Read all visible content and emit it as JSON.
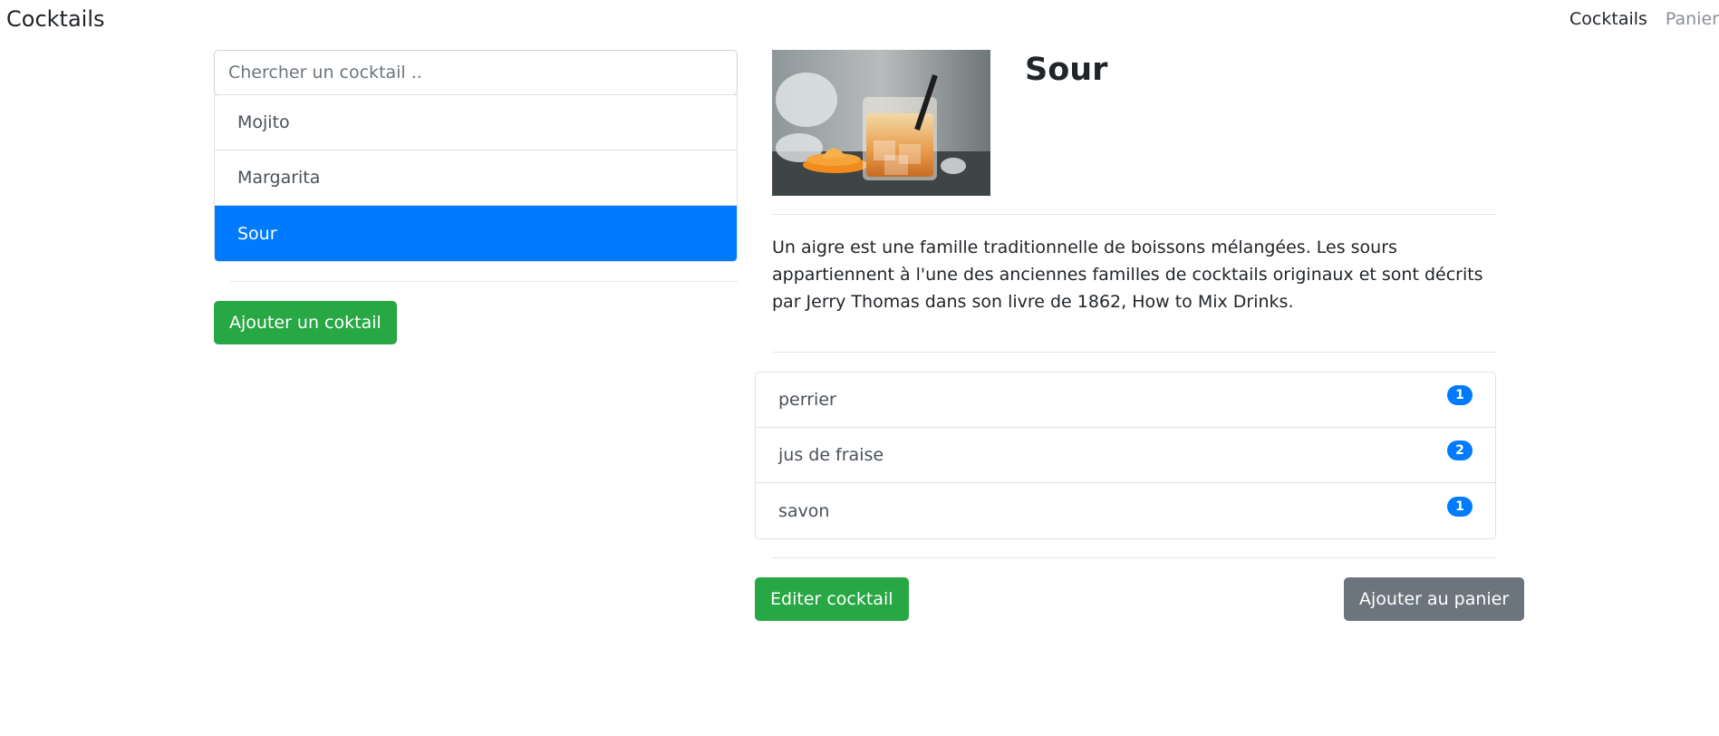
{
  "navbar": {
    "brand": "Cocktails",
    "links": [
      {
        "label": "Cocktails",
        "active": true
      },
      {
        "label": "Panier",
        "active": false
      }
    ]
  },
  "sidebar": {
    "search_placeholder": "Chercher un cocktail ..",
    "search_value": "",
    "cocktails": [
      {
        "name": "Mojito",
        "selected": false
      },
      {
        "name": "Margarita",
        "selected": false
      },
      {
        "name": "Sour",
        "selected": true
      }
    ],
    "add_button": "Ajouter un coktail"
  },
  "detail": {
    "title": "Sour",
    "image_icon": "cocktail-photo",
    "description": "Un aigre est une famille traditionnelle de boissons mélangées. Les sours appartiennent à l'une des anciennes familles de cocktails originaux et sont décrits par Jerry Thomas dans son livre de 1862, How to Mix Drinks.",
    "ingredients": [
      {
        "name": "perrier",
        "quantity": "1"
      },
      {
        "name": "jus de fraise",
        "quantity": "2"
      },
      {
        "name": "savon",
        "quantity": "1"
      }
    ],
    "edit_button": "Editer cocktail",
    "add_to_cart_button": "Ajouter au panier"
  },
  "colors": {
    "primary": "#007bff",
    "success": "#28a745",
    "secondary": "#6c757d"
  }
}
